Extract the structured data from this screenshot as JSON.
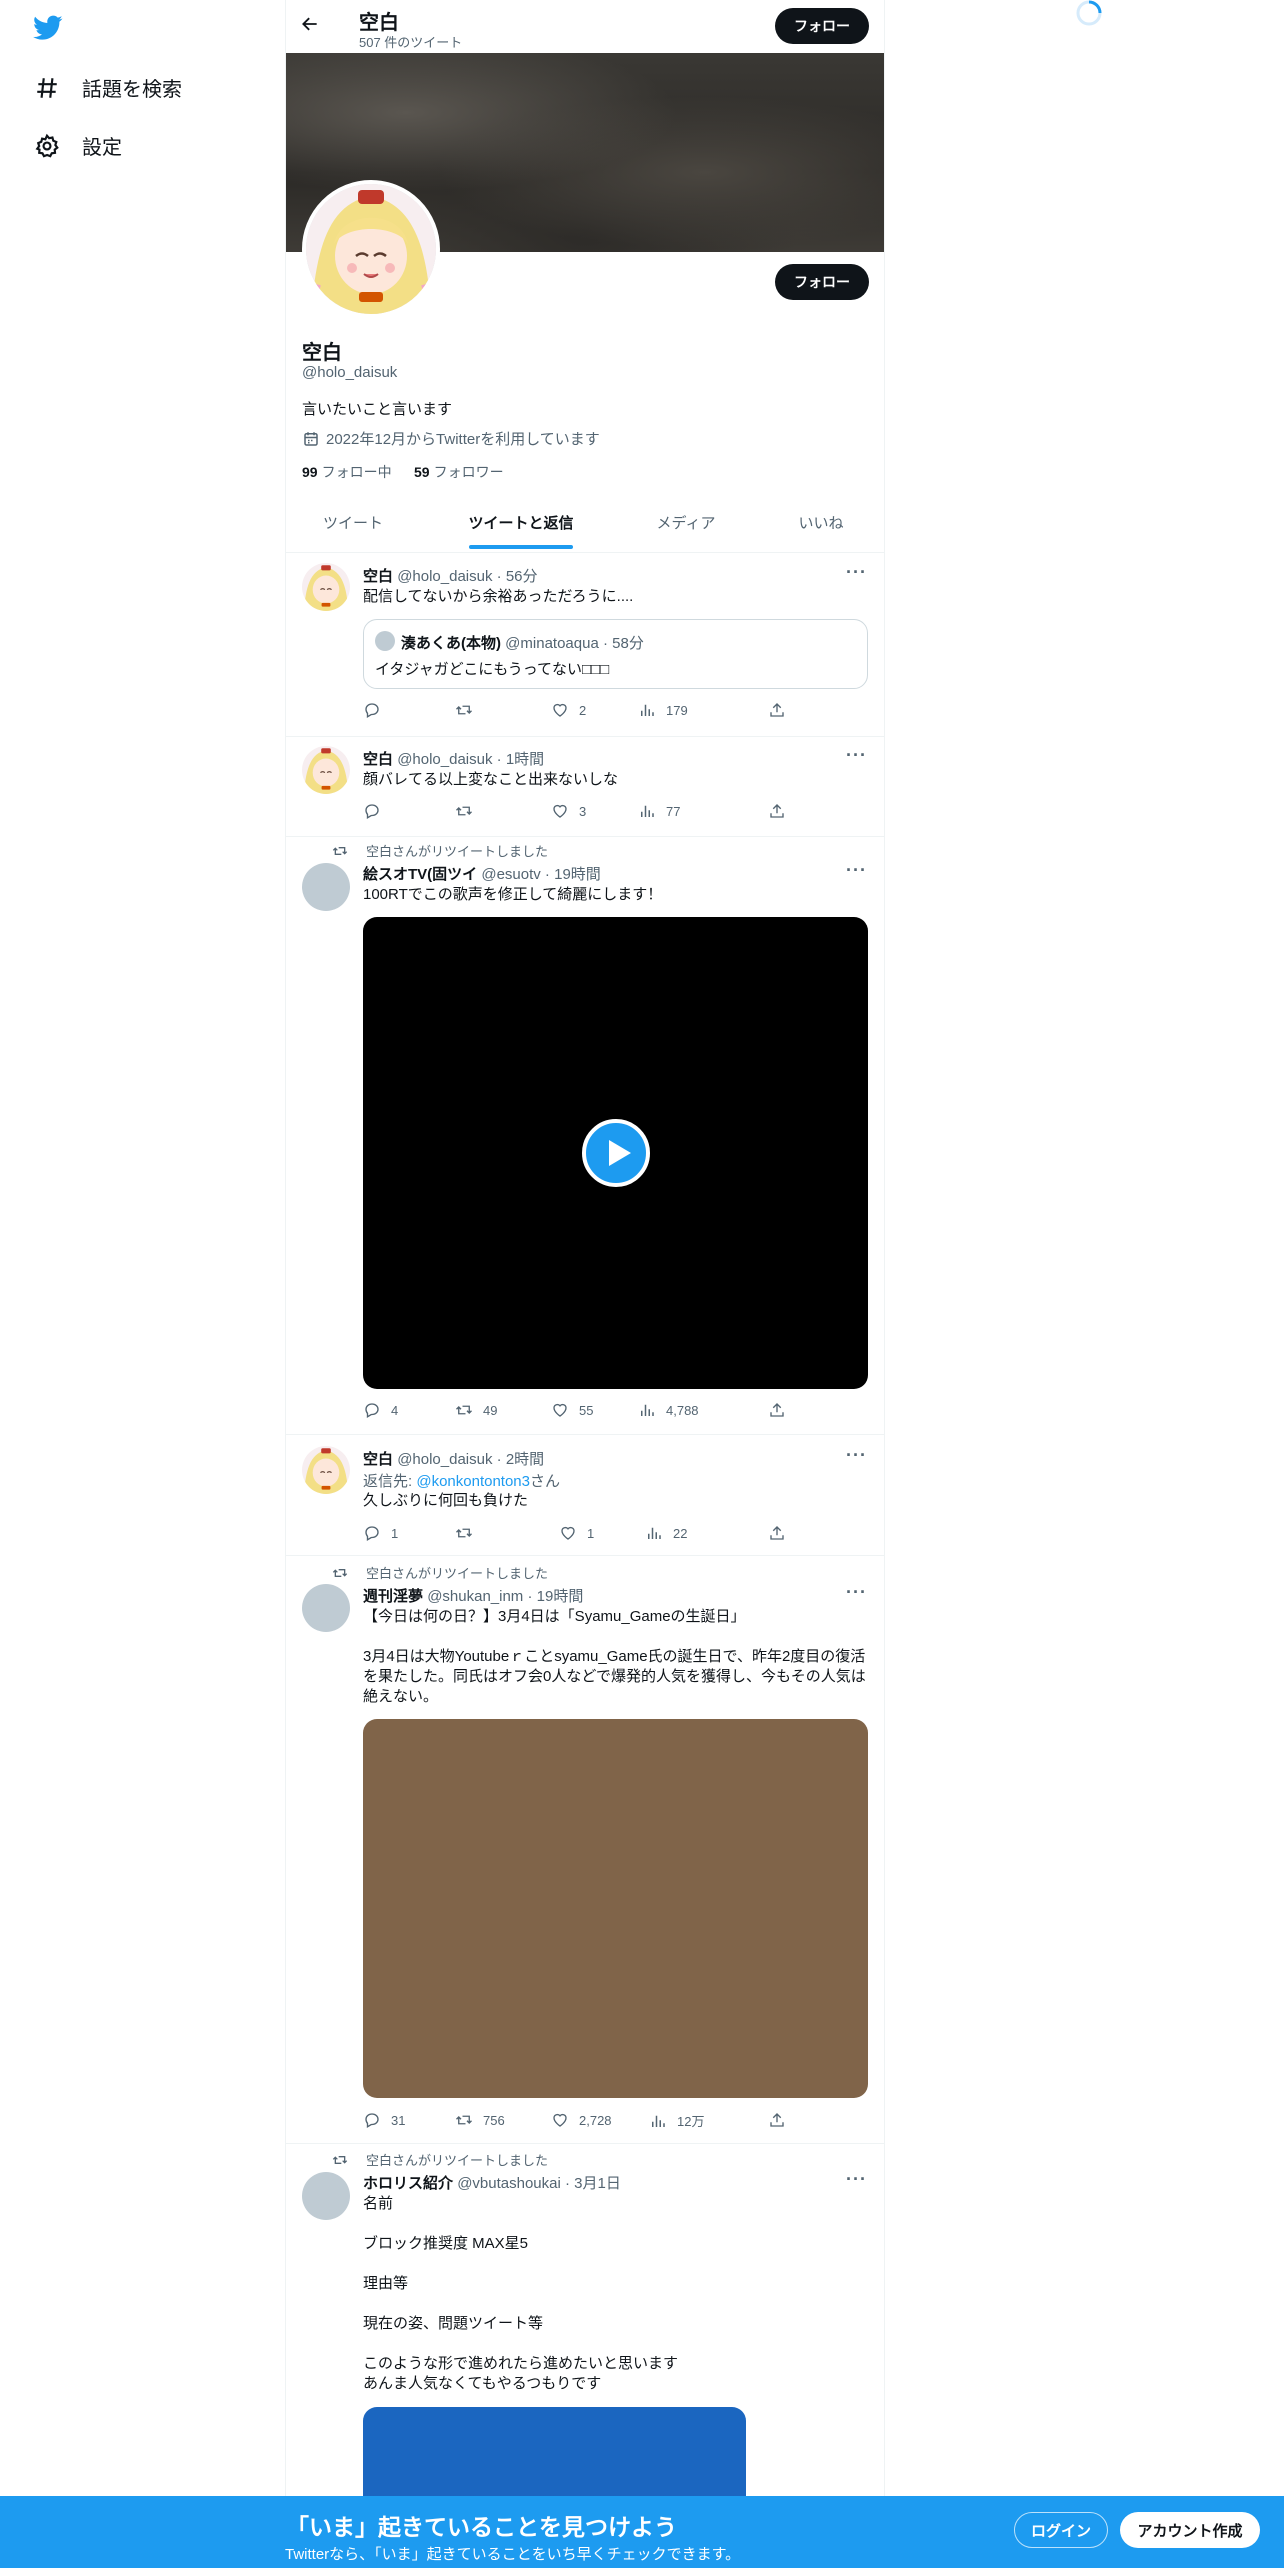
{
  "nav": {
    "explore": "話題を検索",
    "settings": "設定"
  },
  "header": {
    "name": "空白",
    "tweet_count": "507 件のツイート",
    "follow": "フォロー"
  },
  "profile": {
    "follow_button": "フォロー",
    "name": "空白",
    "handle": "@holo_daisuk",
    "bio": "言いたいこと言います",
    "joined": "2022年12月からTwitterを利用しています",
    "following_count": "99",
    "following_label": "フォロー中",
    "followers_count": "59",
    "followers_label": "フォロワー"
  },
  "tabs": [
    "ツイート",
    "ツイートと返信",
    "メディア",
    "いいね"
  ],
  "tweets": [
    {
      "name": "空白",
      "handle": "@holo_daisuk",
      "time": "56分",
      "text": "配信してないから余裕あっただろうに....",
      "quote": {
        "name": "湊あくあ(本物)",
        "handle": "@minatoaqua",
        "time": "58分",
        "text": "イタジャガどこにもうってない□□□"
      },
      "reply": "",
      "retweet": "",
      "like": "2",
      "views": "179"
    },
    {
      "name": "空白",
      "handle": "@holo_daisuk",
      "time": "1時間",
      "text": "顔バレてる以上変なこと出来ないしな",
      "reply": "",
      "retweet": "",
      "like": "3",
      "views": "77"
    },
    {
      "retweeted_by": "空白さんがリツイートしました",
      "name": "絵スオTV(固ツイ",
      "handle": "@esuotv",
      "time": "19時間",
      "text": "100RTでこの歌声を修正して綺麗にします！",
      "reply": "4",
      "retweet": "49",
      "like": "55",
      "views": "4,788"
    },
    {
      "name": "空白",
      "handle": "@holo_daisuk",
      "time": "2時間",
      "reply_to_label": "返信先: ",
      "reply_to": "@konkontonton3",
      "reply_to_suffix": "さん",
      "text": "久しぶりに何回も負けた",
      "reply": "1",
      "retweet": "",
      "like": "1",
      "views": "22"
    },
    {
      "retweeted_by": "空白さんがリツイートしました",
      "name": "週刊淫夢",
      "handle": "@shukan_inm",
      "time": "19時間",
      "text_lines": [
        "【今日は何の日？】3月4日は「Syamu_Gameの生誕日」",
        "",
        "3月4日は大物Youtubeｒことsyamu_Game氏の誕生日で、昨年2度目の復活",
        "を果たした。同氏はオフ会0人などで爆発的人気を獲得し、今もその人気は",
        "絶えない。"
      ],
      "reply": "31",
      "retweet": "756",
      "like": "2,728",
      "views": "12万"
    },
    {
      "retweeted_by": "空白さんがリツイートしました",
      "name": "ホロリス紹介",
      "handle": "@vbutashoukai",
      "time": "3月1日",
      "text_lines": [
        "名前",
        "",
        "ブロック推奨度 MAX星5",
        "",
        "理由等",
        "",
        "現在の姿、問題ツイート等",
        "",
        "このような形で進めれたら進めたいと思います",
        "あんま人気なくてもやるつもりです"
      ]
    }
  ],
  "footer": {
    "title": "「いま」起きていることを見つけよう",
    "subtitle": "Twitterなら、「いま」起きていることをいち早くチェックできます。",
    "login": "ログイン",
    "signup": "アカウント作成"
  },
  "colors": {
    "accent": "#1d9bf0",
    "text": "#0f1419",
    "muted": "#536471"
  }
}
